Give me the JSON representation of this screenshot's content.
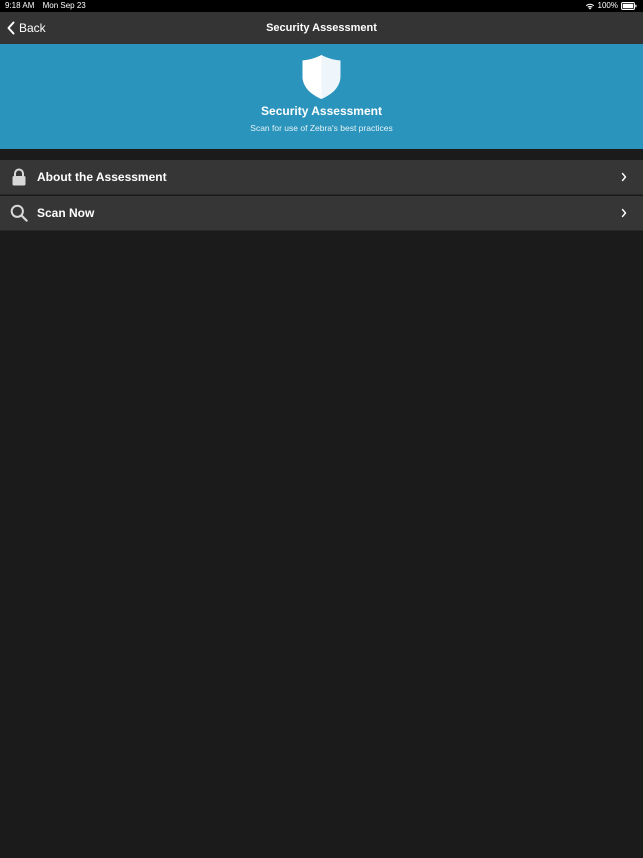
{
  "status_bar": {
    "time": "9:18 AM",
    "date": "Mon Sep 23",
    "battery": "100%"
  },
  "nav": {
    "back_label": "Back",
    "title": "Security Assessment"
  },
  "hero": {
    "icon": "shield-icon",
    "title": "Security Assessment",
    "subtitle": "Scan for use of Zebra's best practices"
  },
  "menu": {
    "items": [
      {
        "icon": "lock-icon",
        "label": "About the Assessment"
      },
      {
        "icon": "search-icon",
        "label": "Scan Now"
      }
    ]
  },
  "colors": {
    "background": "#1b1b1b",
    "nav_bar": "#343434",
    "hero": "#2a94bd",
    "menu_item": "#363636"
  }
}
